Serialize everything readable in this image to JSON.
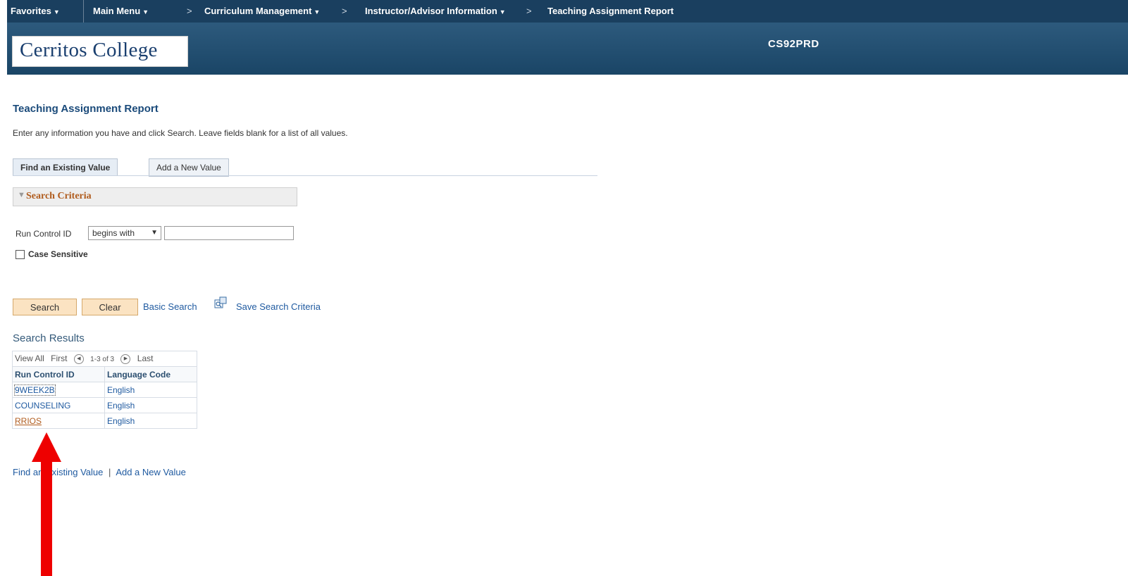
{
  "nav": {
    "favorites": "Favorites",
    "main_menu": "Main Menu",
    "crumb1": "Curriculum Management",
    "crumb2": "Instructor/Advisor Information",
    "crumb3": "Teaching Assignment Report",
    "chevron": ">"
  },
  "header": {
    "logo": "Cerritos College",
    "db": "CS92PRD"
  },
  "page": {
    "title": "Teaching Assignment Report",
    "instructions": "Enter any information you have and click Search. Leave fields blank for a list of all values."
  },
  "tabs": [
    {
      "label": "Find an Existing Value"
    },
    {
      "label": "Add a New Value"
    }
  ],
  "search_criteria": {
    "title": "Search Criteria",
    "run_control_label": "Run Control ID",
    "operator": "begins with",
    "value": "",
    "case_sensitive_label": "Case Sensitive"
  },
  "actions": {
    "search": "Search",
    "clear": "Clear",
    "basic_search": "Basic Search",
    "save_search": "Save Search Criteria"
  },
  "results": {
    "title": "Search Results",
    "view_all": "View All",
    "first": "First",
    "range": "1-3 of 3",
    "last": "Last",
    "columns": [
      "Run Control ID",
      "Language Code"
    ],
    "rows": [
      [
        "9WEEK2B",
        "English"
      ],
      [
        "COUNSELING",
        "English"
      ],
      [
        "RRIOS",
        "English"
      ]
    ]
  },
  "footer": {
    "find_existing": "Find an Existing Value",
    "separator": "|",
    "add_new": "Add a New Value"
  },
  "colors": {
    "nav_bg": "#1a3f5f",
    "link": "#1f5aa0",
    "annotation_arrow": "#ee0000"
  }
}
